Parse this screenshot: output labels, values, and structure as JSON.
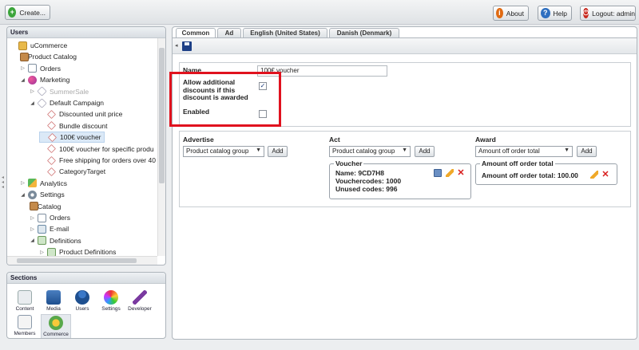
{
  "toolbar": {
    "create_label": "Create...",
    "about_label": "About",
    "help_label": "Help",
    "logout_label": "Logout: admin"
  },
  "users_panel": {
    "title": "Users",
    "tree": [
      {
        "label": "uCommerce",
        "icon": "folder-icon"
      },
      {
        "label": "Product Catalog",
        "icon": "box-icon"
      },
      {
        "label": "Orders",
        "icon": "document-icon"
      },
      {
        "label": "Marketing",
        "icon": "marketing-icon"
      },
      {
        "label": "SummerSale",
        "icon": "tag-icon"
      },
      {
        "label": "Default Campaign",
        "icon": "tag-icon"
      },
      {
        "label": "Discounted unit price",
        "icon": "discount-tag-icon"
      },
      {
        "label": "Bundle discount",
        "icon": "discount-tag-icon"
      },
      {
        "label": "100€ voucher",
        "icon": "discount-tag-icon"
      },
      {
        "label": "100€ voucher for specific produ",
        "icon": "discount-tag-icon"
      },
      {
        "label": "Free shipping for orders over 40",
        "icon": "discount-tag-icon"
      },
      {
        "label": "CategoryTarget",
        "icon": "discount-tag-icon"
      },
      {
        "label": "Analytics",
        "icon": "chart-icon"
      },
      {
        "label": "Settings",
        "icon": "gear-icon"
      },
      {
        "label": "Catalog",
        "icon": "box-icon"
      },
      {
        "label": "Orders",
        "icon": "document-icon"
      },
      {
        "label": "E-mail",
        "icon": "mail-icon"
      },
      {
        "label": "Definitions",
        "icon": "definitions-icon"
      },
      {
        "label": "Product Definitions",
        "icon": "definitions-icon"
      }
    ]
  },
  "sections_panel": {
    "title": "Sections",
    "items": [
      {
        "label": "Content",
        "icon": "content-icon"
      },
      {
        "label": "Media",
        "icon": "media-icon"
      },
      {
        "label": "Users",
        "icon": "users-icon"
      },
      {
        "label": "Settings",
        "icon": "settings-icon"
      },
      {
        "label": "Developer",
        "icon": "developer-icon"
      },
      {
        "label": "Members",
        "icon": "members-icon"
      },
      {
        "label": "Commerce",
        "icon": "commerce-icon"
      }
    ]
  },
  "editor": {
    "tabs": [
      "Common",
      "Ad",
      "English (United States)",
      "Danish (Denmark)"
    ],
    "active_tab": "Common",
    "name_label": "Name",
    "name_value": "100€ voucher",
    "allow_additional_label": "Allow additional discounts if this discount is awarded",
    "allow_additional_checked": true,
    "enabled_label": "Enabled",
    "enabled_checked": false,
    "highlight_color": "#e0121e"
  },
  "advertise": {
    "title": "Advertise",
    "select_value": "Product catalog group",
    "add_label": "Add"
  },
  "act": {
    "title": "Act",
    "select_value": "Product catalog group",
    "add_label": "Add",
    "voucher": {
      "legend": "Voucher",
      "name": "Name: 9CD7H8",
      "vouchercodes": "Vouchercodes: 1000",
      "unused": "Unused codes: 996"
    }
  },
  "award": {
    "title": "Award",
    "select_value": "Amount off order total",
    "add_label": "Add",
    "item": {
      "legend": "Amount off order total",
      "text": "Amount off order total: 100.00"
    }
  }
}
